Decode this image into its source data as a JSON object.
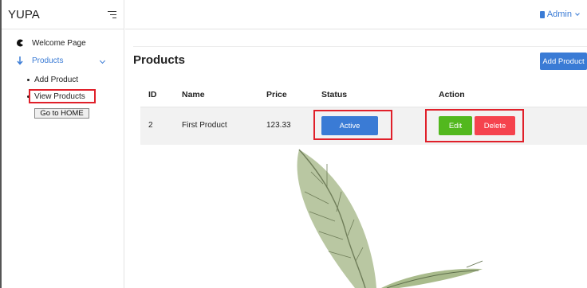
{
  "brand": {
    "name": "YUPA"
  },
  "sidebar": {
    "items": [
      {
        "label": "Welcome Page",
        "icon": "pacman-icon"
      },
      {
        "label": "Products",
        "icon": "arrow-down-icon",
        "expanded": true,
        "color": "#3a7bd5"
      }
    ],
    "sub_items": [
      {
        "label": "Add Product"
      },
      {
        "label": "View Products",
        "highlighted": true
      }
    ],
    "home_button": "Go to HOME"
  },
  "topbar": {
    "user_label": "Admin",
    "user_icon": "user-icon"
  },
  "page": {
    "title": "Products",
    "add_button": "Add Product"
  },
  "table": {
    "headers": [
      "ID",
      "Name",
      "Price",
      "Status",
      "Action"
    ],
    "rows": [
      {
        "id": "2",
        "name": "First Product",
        "price": "123.33",
        "status": "Active",
        "edit": "Edit",
        "delete": "Delete"
      }
    ]
  },
  "colors": {
    "accent": "#3a7bd5",
    "success": "#52b81e",
    "danger": "#f5434e",
    "annotation": "#e0202a"
  }
}
